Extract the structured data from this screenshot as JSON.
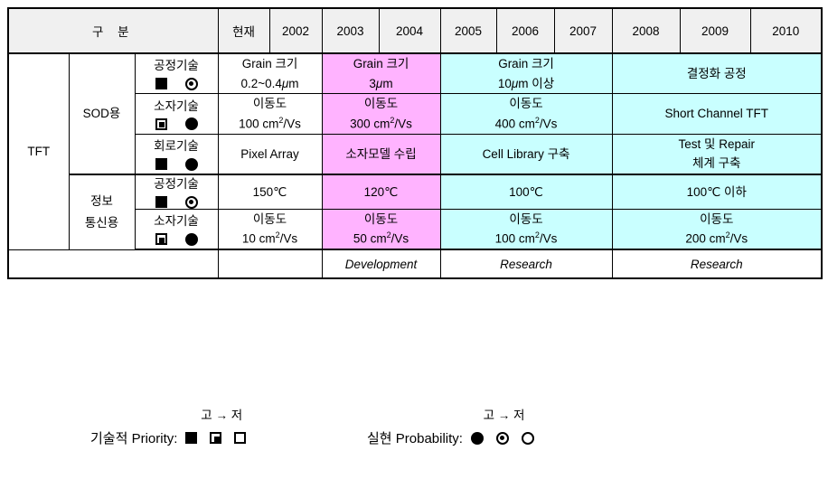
{
  "table": {
    "header": {
      "division_label": "구  분",
      "now_label": "현재",
      "years": [
        "2002",
        "2003",
        "2004",
        "2005",
        "2006",
        "2007",
        "2008",
        "2009",
        "2010"
      ]
    },
    "root_label": "TFT",
    "groups": [
      {
        "label": "SOD용"
      },
      {
        "label_line1": "정보",
        "label_line2": "통신용"
      }
    ],
    "rows": [
      {
        "tech": "공정기술",
        "priority_symbol": "filled-square",
        "probability_symbol": "dot-circle",
        "cells": [
          {
            "line1": "Grain 크기",
            "line2": "0.2~0.4μm",
            "bg": "white"
          },
          {
            "line1": "Grain 크기",
            "line2": "3μm",
            "bg": "pink"
          },
          {
            "line1": "Grain 크기",
            "line2": "10μm 이상",
            "bg": "cyan"
          },
          {
            "line1": "결정화 공정",
            "line2": "",
            "bg": "cyan"
          }
        ]
      },
      {
        "tech": "소자기술",
        "priority_symbol": "dot-square",
        "probability_symbol": "filled-circle",
        "cells": [
          {
            "line1": "이동도",
            "line2": "100 cm2/Vs",
            "bg": "white"
          },
          {
            "line1": "이동도",
            "line2": "300 cm2/Vs",
            "bg": "pink"
          },
          {
            "line1": "이동도",
            "line2": "400 cm2/Vs",
            "bg": "cyan"
          },
          {
            "line1": "Short Channel TFT",
            "line2": "",
            "bg": "cyan"
          }
        ]
      },
      {
        "tech": "회로기술",
        "priority_symbol": "filled-square",
        "probability_symbol": "filled-circle",
        "cells": [
          {
            "line1": "Pixel Array",
            "line2": "",
            "bg": "white"
          },
          {
            "line1": "소자모델 수립",
            "line2": "",
            "bg": "pink"
          },
          {
            "line1": "Cell Library 구축",
            "line2": "",
            "bg": "cyan"
          },
          {
            "line1": "Test 및 Repair",
            "line2": "체계 구축",
            "bg": "cyan"
          }
        ]
      },
      {
        "tech": "공정기술",
        "priority_symbol": "filled-square",
        "probability_symbol": "dot-circle",
        "cells": [
          {
            "line1": "150℃",
            "line2": "",
            "bg": "white"
          },
          {
            "line1": "120℃",
            "line2": "",
            "bg": "pink"
          },
          {
            "line1": "100℃",
            "line2": "",
            "bg": "cyan"
          },
          {
            "line1": "100℃ 이하",
            "line2": "",
            "bg": "cyan"
          }
        ]
      },
      {
        "tech": "소자기술",
        "priority_symbol": "dot-square",
        "probability_symbol": "filled-circle",
        "cells": [
          {
            "line1": "이동도",
            "line2": "10 cm2/Vs",
            "bg": "white"
          },
          {
            "line1": "이동도",
            "line2": "50 cm2/Vs",
            "bg": "pink"
          },
          {
            "line1": "이동도",
            "line2": "100 cm2/Vs",
            "bg": "cyan"
          },
          {
            "line1": "이동도",
            "line2": "200 cm2/Vs",
            "bg": "cyan"
          }
        ]
      }
    ],
    "phase_row": {
      "empty_label": "",
      "phases": [
        "",
        "Development",
        "Research",
        "Research"
      ]
    }
  },
  "legend": {
    "priority": {
      "arrow_text": "고 → 저",
      "label": "기술적 Priority:",
      "symbols": [
        "filled-square",
        "dot-square",
        "open-square"
      ]
    },
    "probability": {
      "arrow_text": "고 → 저",
      "label": "실현 Probability:",
      "symbols": [
        "filled-circle",
        "dot-circle",
        "open-circle"
      ]
    }
  },
  "colors": {
    "pink": "#ffb3ff",
    "cyan": "#c9ffff",
    "header_gray": "#f0f0f0",
    "border": "#000000"
  }
}
